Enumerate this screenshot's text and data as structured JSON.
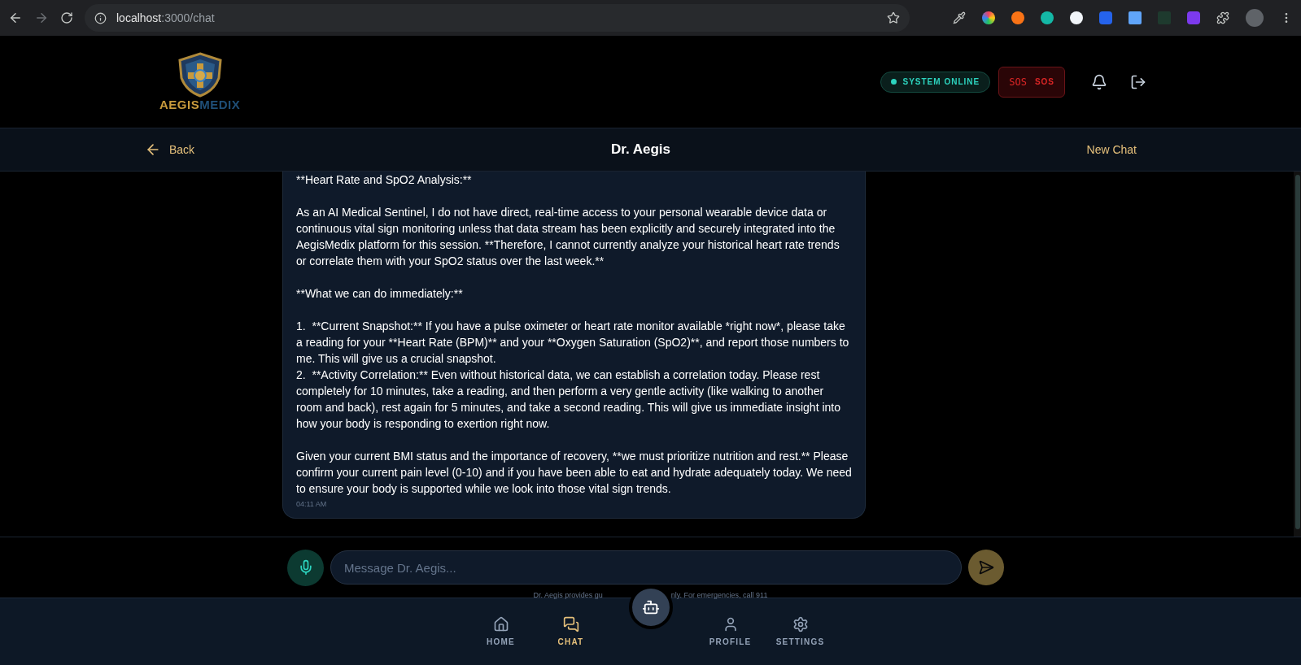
{
  "browser": {
    "host": "localhost",
    "path": ":3000/chat"
  },
  "header": {
    "logo": {
      "first": "AEGIS",
      "second": "MEDIX"
    },
    "status": "SYSTEM ONLINE",
    "sos": {
      "glyph": "SOS",
      "label": "SOS"
    }
  },
  "chat_bar": {
    "back": "Back",
    "title": "Dr. Aegis",
    "action": "New Chat"
  },
  "message": {
    "blocks": [
      {
        "kind": "paragraph",
        "text": "**Heart Rate and SpO2 Analysis:**"
      },
      {
        "kind": "paragraph",
        "text": "As an AI Medical Sentinel, I do not have direct, real-time access to your personal wearable device data or continuous vital sign monitoring unless that data stream has been explicitly and securely integrated into the AegisMedix platform for this session. **Therefore, I cannot currently analyze your historical heart rate trends or correlate them with your SpO2 status over the last week.**"
      },
      {
        "kind": "paragraph",
        "text": "**What we can do immediately:**"
      },
      {
        "kind": "list_item",
        "text": "1.  **Current Snapshot:** If you have a pulse oximeter or heart rate monitor available *right now*, please take a reading for your **Heart Rate (BPM)** and your **Oxygen Saturation (SpO2)**, and report those numbers to me. This will give us a crucial snapshot."
      },
      {
        "kind": "list_item",
        "text": "2.  **Activity Correlation:** Even without historical data, we can establish a correlation today. Please rest completely for 10 minutes, take a reading, and then perform a very gentle activity (like walking to another room and back), rest again for 5 minutes, and take a second reading. This will give us immediate insight into how your body is responding to exertion right now."
      },
      {
        "kind": "paragraph",
        "text": "Given your current BMI status and the importance of recovery, **we must prioritize nutrition and rest.** Please confirm your current pain level (0-10) and if you have been able to eat and hydrate adequately today. We need to ensure your body is supported while we look into those vital sign trends."
      }
    ],
    "time": "04:11 AM"
  },
  "composer": {
    "placeholder": "Message Dr. Aegis..."
  },
  "disclaimer": {
    "before": "Dr. Aegis provides gu",
    "after": "nly. For emergencies, call 911"
  },
  "nav": [
    {
      "kind": "tab",
      "label": "HOME",
      "selected": false
    },
    {
      "kind": "tab",
      "label": "CHAT",
      "selected": true
    },
    {
      "kind": "center"
    },
    {
      "kind": "tab",
      "label": "PROFILE",
      "selected": false
    },
    {
      "kind": "tab",
      "label": "SETTINGS",
      "selected": false
    }
  ]
}
